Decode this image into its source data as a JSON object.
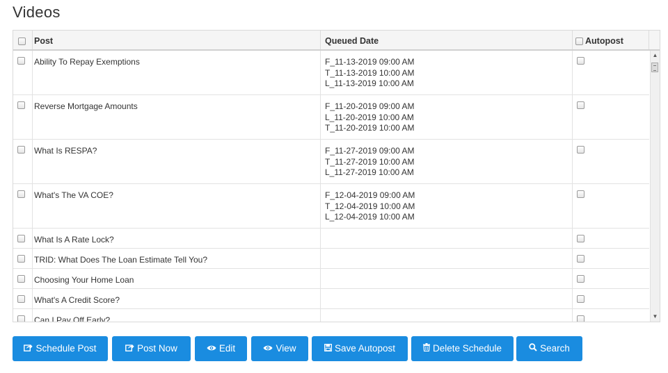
{
  "page": {
    "title": "Videos"
  },
  "grid": {
    "columns": {
      "post": "Post",
      "queued_date": "Queued Date",
      "autopost": "Autopost"
    },
    "rows": [
      {
        "post": "Ability To Repay Exemptions",
        "dates": [
          "F_11-13-2019 09:00 AM",
          "T_11-13-2019 10:00 AM",
          "L_11-13-2019 10:00 AM"
        ]
      },
      {
        "post": "Reverse Mortgage Amounts",
        "dates": [
          "F_11-20-2019 09:00 AM",
          "L_11-20-2019 10:00 AM",
          "T_11-20-2019 10:00 AM"
        ]
      },
      {
        "post": "What Is RESPA?",
        "dates": [
          "F_11-27-2019 09:00 AM",
          "T_11-27-2019 10:00 AM",
          "L_11-27-2019 10:00 AM"
        ]
      },
      {
        "post": "What's The VA COE?",
        "dates": [
          "F_12-04-2019 09:00 AM",
          "T_12-04-2019 10:00 AM",
          "L_12-04-2019 10:00 AM"
        ]
      },
      {
        "post": "What Is A Rate Lock?",
        "dates": []
      },
      {
        "post": "TRID: What Does The Loan Estimate Tell You?",
        "dates": []
      },
      {
        "post": "Choosing Your Home Loan",
        "dates": []
      },
      {
        "post": "What's A Credit Score?",
        "dates": []
      },
      {
        "post": "Can I Pay Off Early?",
        "dates": []
      }
    ]
  },
  "toolbar": {
    "schedule_post": "Schedule Post",
    "post_now": "Post Now",
    "edit": "Edit",
    "view": "View",
    "save_autopost": "Save Autopost",
    "delete_schedule": "Delete Schedule",
    "search": "Search"
  },
  "icons": {
    "schedule_post": "share-icon",
    "post_now": "share-icon",
    "edit": "eye-icon",
    "view": "eye-icon",
    "save_autopost": "floppy-icon",
    "delete_schedule": "trash-icon",
    "search": "search-icon"
  },
  "colors": {
    "button": "#1a8ce0",
    "header_bg": "#f5f5f5"
  }
}
